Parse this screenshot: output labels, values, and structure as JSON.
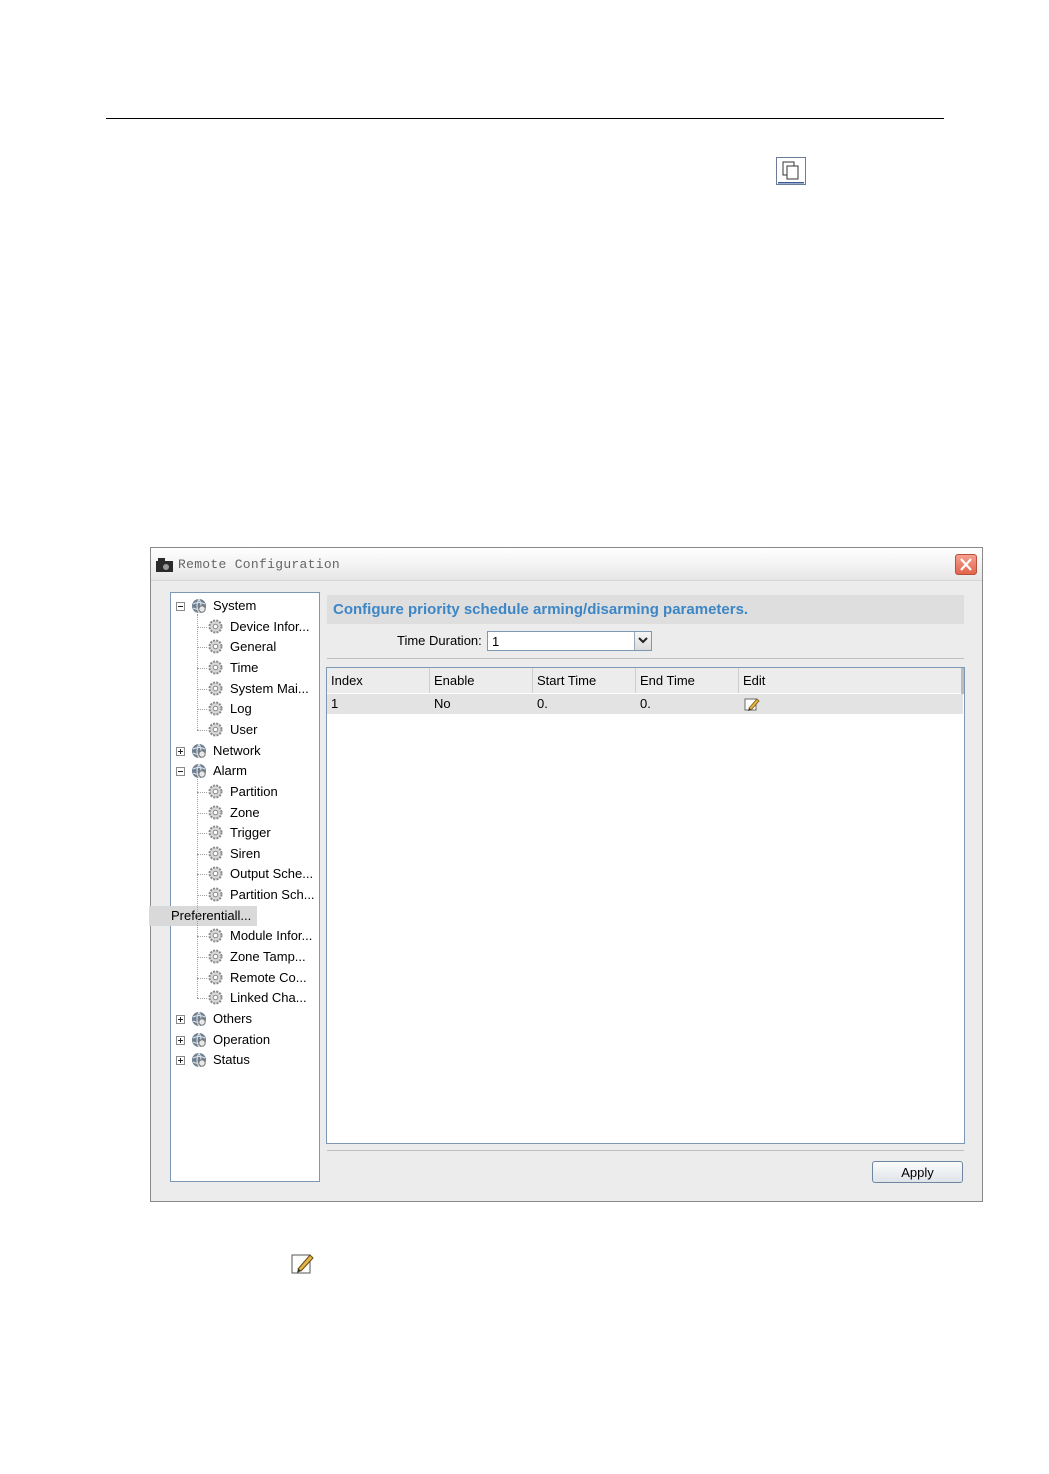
{
  "window": {
    "title": "Remote Configuration"
  },
  "tree": {
    "items": [
      {
        "label": "System",
        "level": 0,
        "expanded": true
      },
      {
        "label": "Device Infor...",
        "level": 1
      },
      {
        "label": "General",
        "level": 1
      },
      {
        "label": "Time",
        "level": 1
      },
      {
        "label": "System Mai...",
        "level": 1
      },
      {
        "label": "Log",
        "level": 1
      },
      {
        "label": "User",
        "level": 1
      },
      {
        "label": "Network",
        "level": 0,
        "expanded": false
      },
      {
        "label": "Alarm",
        "level": 0,
        "expanded": true
      },
      {
        "label": "Partition",
        "level": 1
      },
      {
        "label": "Zone",
        "level": 1
      },
      {
        "label": "Trigger",
        "level": 1
      },
      {
        "label": "Siren",
        "level": 1
      },
      {
        "label": "Output Sche...",
        "level": 1
      },
      {
        "label": "Partition Sch...",
        "level": 1
      },
      {
        "label": "Preferentiall...",
        "level": 1,
        "selected": true
      },
      {
        "label": "Module Infor...",
        "level": 1
      },
      {
        "label": "Zone Tamp...",
        "level": 1
      },
      {
        "label": "Remote Co...",
        "level": 1
      },
      {
        "label": "Linked Cha...",
        "level": 1
      },
      {
        "label": "Others",
        "level": 0,
        "expanded": false
      },
      {
        "label": "Operation",
        "level": 0,
        "expanded": false
      },
      {
        "label": "Status",
        "level": 0,
        "expanded": false
      }
    ]
  },
  "main": {
    "header": "Configure priority schedule arming/disarming parameters.",
    "time_duration_label": "Time Duration:",
    "time_duration_value": "1",
    "table": {
      "columns": [
        "Index",
        "Enable",
        "Start Time",
        "End Time",
        "Edit"
      ],
      "rows": [
        {
          "index": "1",
          "enable": "No",
          "start_time": "0.",
          "end_time": "0.",
          "edit_icon": "edit-icon"
        }
      ]
    },
    "apply_label": "Apply"
  },
  "colors": {
    "header_text": "#3d86c6",
    "close_button": "#e2634b",
    "panel_border": "#7d98b3"
  },
  "icons": {
    "copy": "copy-icon",
    "edit": "edit-icon",
    "tree_group": "globe-icon",
    "tree_leaf": "gear-icon"
  }
}
